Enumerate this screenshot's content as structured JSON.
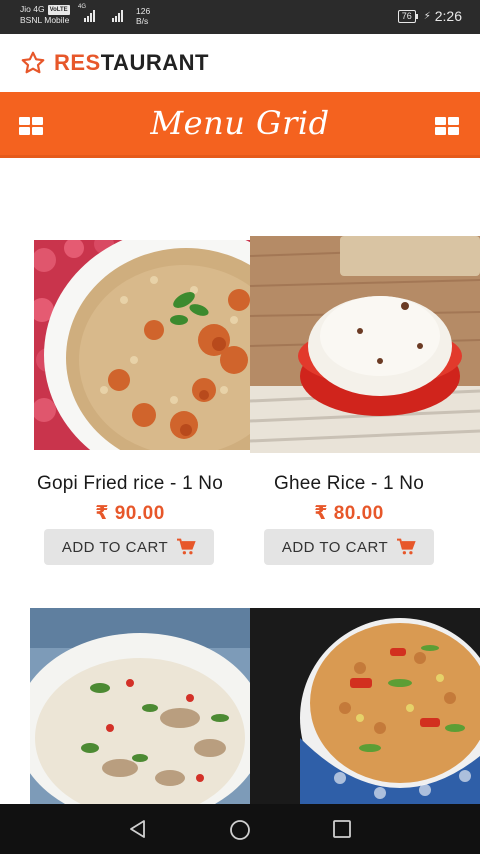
{
  "status_bar": {
    "carrier1": "Jio 4G",
    "volte": "VoLTE",
    "carrier2": "BSNL Mobile",
    "network": "4G",
    "speed_value": "126",
    "speed_unit": "B/s",
    "battery": "76",
    "time": "2:26"
  },
  "header": {
    "brand_accent": "RES",
    "brand_rest": "TAURANT"
  },
  "menu_bar": {
    "title": "Menu Grid"
  },
  "products": [
    {
      "name": "Gopi Fried rice - 1 No",
      "price": "₹ 90.00",
      "button": "ADD TO CART"
    },
    {
      "name": "Ghee Rice - 1 No",
      "price": "₹ 80.00",
      "button": "ADD TO CART"
    }
  ],
  "colors": {
    "accent": "#f4621f",
    "price": "#e7572a"
  },
  "icons": [
    "star-icon",
    "grid-icon",
    "cart-icon",
    "back-icon",
    "home-icon",
    "recents-icon"
  ]
}
